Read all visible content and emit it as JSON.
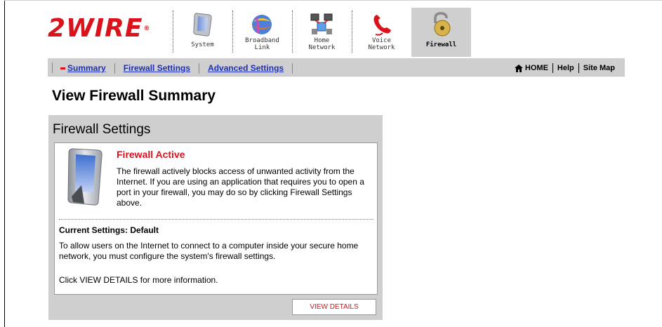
{
  "brand": {
    "logo_text": "2WIRE",
    "logo_mark": "®",
    "color": "#d9121b"
  },
  "nav": {
    "tabs": [
      {
        "label": "System",
        "icon": "system-device-icon",
        "active": false
      },
      {
        "label": "Broadband\nLink",
        "icon": "broadband-globe-icon",
        "active": false
      },
      {
        "label": "Home\nNetwork",
        "icon": "home-network-icon",
        "active": false
      },
      {
        "label": "Voice\nNetwork",
        "icon": "phone-icon",
        "active": false
      },
      {
        "label": "Firewall",
        "icon": "padlock-icon",
        "active": true
      }
    ]
  },
  "subnav": {
    "links": [
      {
        "label": "Summary",
        "active": true
      },
      {
        "label": "Firewall Settings",
        "active": false
      },
      {
        "label": "Advanced Settings",
        "active": false
      }
    ],
    "right": {
      "home": "HOME",
      "help": "Help",
      "sitemap": "Site Map"
    }
  },
  "page": {
    "title": "View Firewall Summary"
  },
  "panel": {
    "title": "Firewall Settings",
    "status_title": "Firewall Active",
    "status_text": "The firewall actively blocks access of unwanted activity from the Internet. If you are using an application that requires you to open a port in your firewall, you may do so by clicking Firewall Settings above.",
    "current_settings": "Current Settings: Default",
    "explain_text": "To allow users on the Internet to connect to a computer inside your secure home network, you must configure the system's firewall settings.",
    "click_text": "Click VIEW DETAILS for more information.",
    "button_label": "VIEW DETAILS"
  },
  "colors": {
    "accent": "#d9121b",
    "link": "#1c2fbf",
    "bar": "#cfcfcf"
  }
}
